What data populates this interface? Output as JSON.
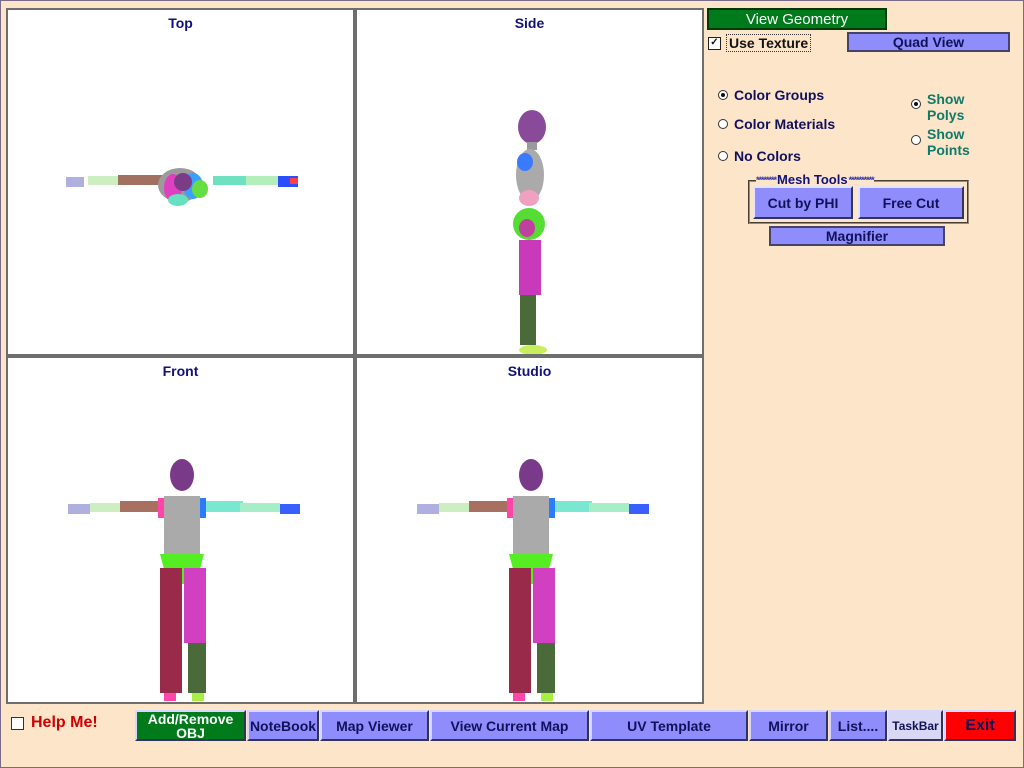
{
  "viewports": {
    "top": "Top",
    "side": "Side",
    "front": "Front",
    "studio": "Studio"
  },
  "panel": {
    "view_geometry": "View Geometry",
    "use_texture": "Use Texture",
    "use_texture_checked": true,
    "quad_view": "Quad View",
    "color_groups": "Color Groups",
    "color_materials": "Color Materials",
    "no_colors": "No Colors",
    "color_selected": "Color Groups",
    "show_polys_1": "Show",
    "show_polys_2": "Polys",
    "show_points_1": "Show",
    "show_points_2": "Points",
    "show_selected": "Polys",
    "mesh_tools": "Mesh Tools",
    "mesh_tools_stars": "********",
    "mesh_tools_stars_right": "**********",
    "cut_by_phi": "Cut by PHI",
    "free_cut": "Free Cut",
    "magnifier": "Magnifier"
  },
  "bottom": {
    "help_me": "Help Me!",
    "help_checked": false,
    "add_remove_1": "Add/Remove",
    "add_remove_2": "OBJ",
    "notebook": "NoteBook",
    "map_viewer": "Map Viewer",
    "view_current_map": "View Current Map",
    "uv_template": "UV Template",
    "mirror": "Mirror",
    "list": "List....",
    "taskbar": "TaskBar",
    "exit": "Exit"
  },
  "colors": {
    "background": "#fde5c9",
    "button_purple": "#8f8dfc",
    "button_green": "#007a1a",
    "exit_red": "#ff0000",
    "title_navy": "#11117a"
  }
}
